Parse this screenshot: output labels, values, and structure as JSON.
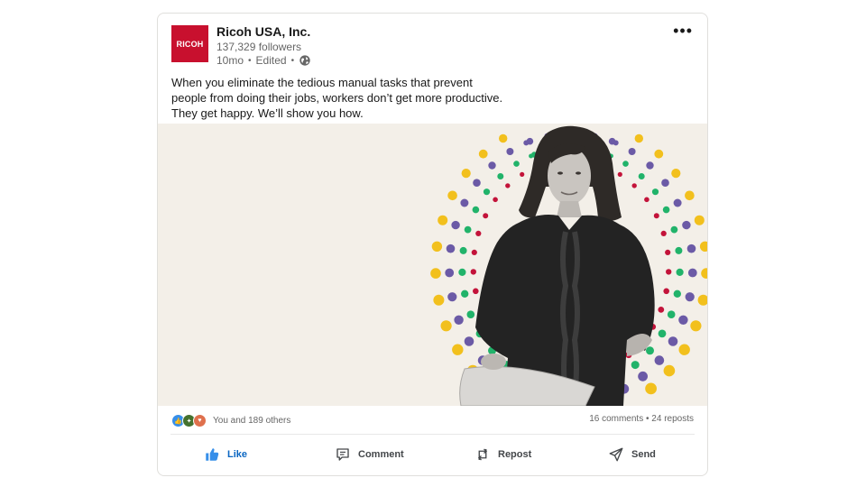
{
  "post": {
    "company": "Ricoh USA, Inc.",
    "logo_text": "RICOH",
    "followers": "137,329 followers",
    "time": "10mo",
    "edited": "Edited",
    "caption_lines": [
      "When you eliminate the tedious manual tasks that prevent",
      "people from doing their jobs, workers don’t get more productive.",
      "They get happy. We’ll show you how."
    ]
  },
  "counts": {
    "reactions_text": "You and 189 others",
    "comments": "16 comments",
    "separator": "•",
    "reposts": "24 reposts"
  },
  "actions": {
    "like": "Like",
    "comment": "Comment",
    "repost": "Repost",
    "send": "Send"
  },
  "colors": {
    "brand_red": "#c8102e",
    "linkedin_blue": "#0a66c2",
    "image_background": "#f3efe8",
    "dot_colors": [
      "#f2c01d",
      "#6b5aa6",
      "#21b36a",
      "#c3133a"
    ]
  },
  "icons": {
    "more": "more-options-icon",
    "visibility": "globe-icon",
    "like": "thumbs-up-icon",
    "comment": "comment-icon",
    "repost": "repost-icon",
    "send": "send-icon"
  }
}
